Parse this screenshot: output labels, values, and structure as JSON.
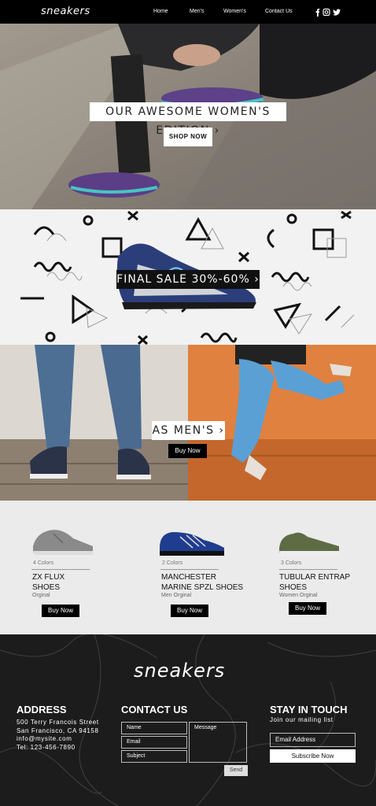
{
  "header": {
    "logo": "sneakers",
    "nav": [
      "Home",
      "Men's",
      "Women's",
      "Contact Us"
    ],
    "social": [
      "f",
      "◙",
      "🐦"
    ]
  },
  "hero": {
    "title": "OUR AWESOME WOMEN'S EDITION ›",
    "button": "SHOP NOW"
  },
  "sale": {
    "title": "FINAL SALE 30%-60% ›"
  },
  "men": {
    "title": "AS MEN'S ›",
    "button": "Buy Now"
  },
  "products": [
    {
      "colors": "4 Colors",
      "name1": "ZX FLUX",
      "name2": "SHOES",
      "sub": "Orginal",
      "button": "Buy Now"
    },
    {
      "colors": "2 Colors",
      "name1": "MANCHESTER",
      "name2": "MARINE SPZL SHOES",
      "sub": "Men Orginal",
      "button": "Buy Now"
    },
    {
      "colors": "3 Colors",
      "name1": "TUBULAR ENTRAP",
      "name2": "SHOES",
      "sub": "Women Orginal",
      "button": "Buy Now"
    }
  ],
  "footer": {
    "logo": "sneakers",
    "address": {
      "heading": "ADDRESS",
      "lines": [
        "500 Terry Francois Street",
        "San Francisco, CA 94158",
        "info@mysite.com",
        "Tel: 123-456-7890"
      ]
    },
    "contact": {
      "heading": "CONTACT US",
      "name": "Name",
      "email": "Email",
      "subject": "Subject",
      "message": "Message",
      "send": "Send"
    },
    "stay": {
      "heading": "STAY IN TOUCH",
      "sub": "Join our mailing list",
      "email_placeholder": "Email Address",
      "button": "Subscribe Now"
    }
  }
}
